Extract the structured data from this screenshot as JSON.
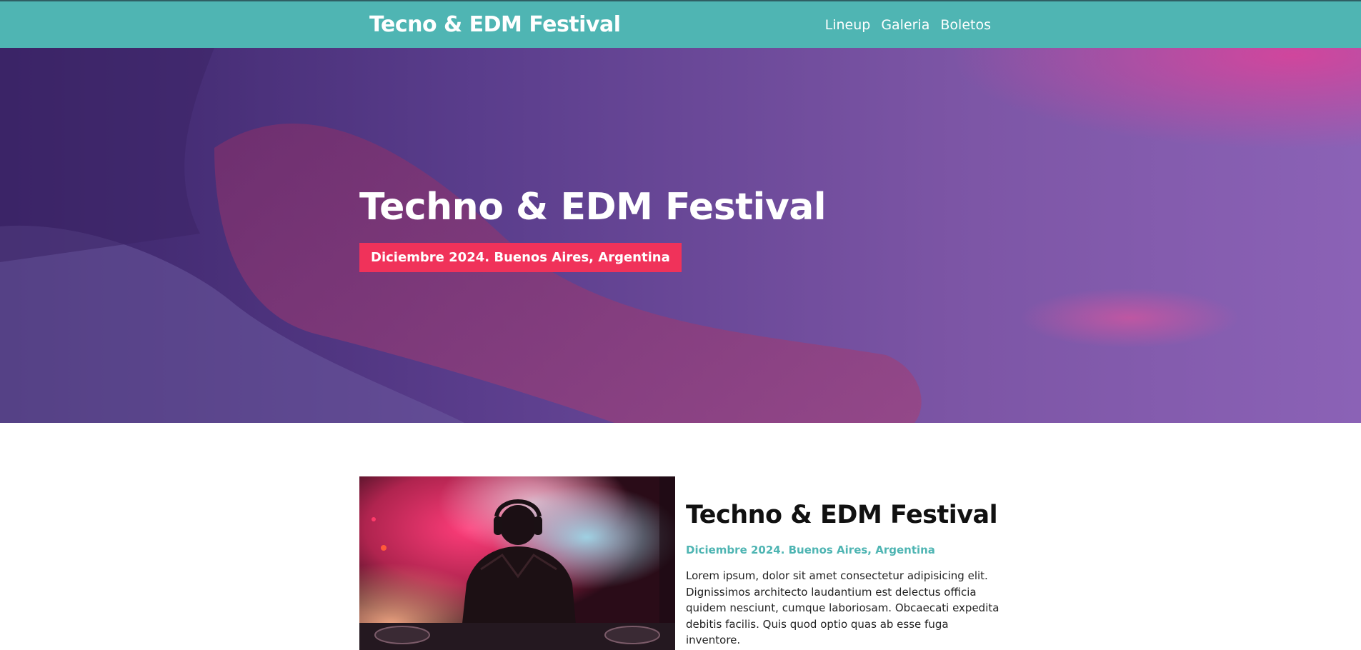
{
  "header": {
    "logo": "Tecno & EDM Festival",
    "nav": [
      {
        "label": "Lineup"
      },
      {
        "label": "Galeria"
      },
      {
        "label": "Boletos"
      }
    ]
  },
  "hero": {
    "title": "Techno & EDM Festival",
    "badge": "Diciembre 2024. Buenos Aires, Argentina"
  },
  "about": {
    "title": "Techno & EDM Festival",
    "subtitle": "Diciembre 2024. Buenos Aires, Argentina",
    "body": "Lorem ipsum, dolor sit amet consectetur adipisicing elit. Dignissimos architecto laudantium est delectus officia quidem nesciunt, cumque laboriosam. Obcaecati expedita debitis facilis. Quis quod optio quas ab esse fuga inventore."
  },
  "colors": {
    "header_bg": "#4fb5b3",
    "accent_pink": "#f0325a",
    "accent_teal": "#4fb5b3",
    "hero_overlay": "#5b3b8a"
  }
}
